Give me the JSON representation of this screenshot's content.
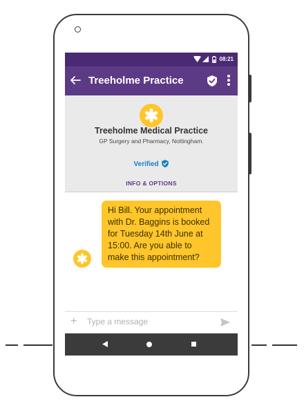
{
  "status_bar": {
    "time": "08:21"
  },
  "app_bar": {
    "title": "Treeholme Practice",
    "back_icon": "arrow-left-icon",
    "verified_icon": "shield-check-icon",
    "menu_icon": "more-vert-icon"
  },
  "business_info": {
    "name": "Treeholme Medical Practice",
    "subtitle": "GP Surgery and Pharmacy, Nottingham.",
    "verified_label": "Verified",
    "options_label": "INFO & OPTIONS",
    "logo_color": "#ffc62b"
  },
  "conversation": {
    "messages": [
      {
        "sender": "business",
        "text": "Hi Bill. Your appointment with Dr. Baggins is booked for Tuesday 14th June at 15:00. Are you able to make this appointment?"
      }
    ]
  },
  "composer": {
    "placeholder": "Type a message"
  },
  "colors": {
    "header": "#5d3a86",
    "status_bar": "#4b2a73",
    "accent": "#ffc62b",
    "verified": "#1a7fc1",
    "nav_bar": "#3b3b3b"
  }
}
